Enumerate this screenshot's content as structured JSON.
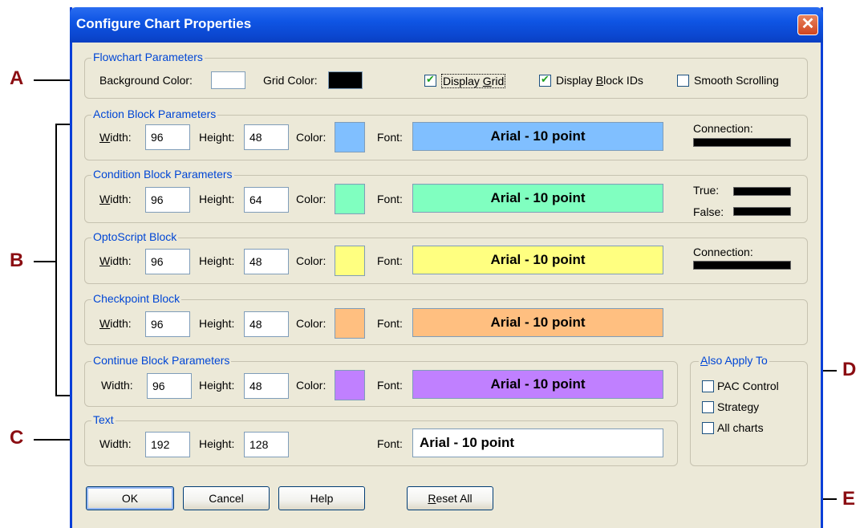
{
  "window": {
    "title": "Configure Chart Properties",
    "close_icon": "close-icon"
  },
  "callouts": {
    "a": "A",
    "b": "B",
    "c": "C",
    "d": "D",
    "e": "E"
  },
  "flowchart": {
    "legend": "Flowchart Parameters",
    "background_color_label": "Background Color:",
    "background_color": "#ffffff",
    "grid_color_label": "Grid Color:",
    "grid_color": "#000000",
    "display_grid_pre": "Display ",
    "display_grid_key": "G",
    "display_grid_post": "rid",
    "display_grid_checked": true,
    "display_block_ids_pre": "Display ",
    "display_block_ids_key": "B",
    "display_block_ids_post": "lock IDs",
    "display_block_ids_checked": true,
    "smooth_scrolling": "Smooth Scrolling",
    "smooth_scrolling_checked": false
  },
  "labels": {
    "width_key": "W",
    "width_rest": "idth:",
    "width_plain": "Width:",
    "height": "Height:",
    "color": "Color:",
    "font": "Font:"
  },
  "action": {
    "legend": "Action Block Parameters",
    "width": "96",
    "height": "48",
    "color": "#80bfff",
    "font": "Arial - 10 point",
    "connection_label": "Connection:"
  },
  "condition": {
    "legend": "Condition Block Parameters",
    "width": "96",
    "height": "64",
    "color": "#80ffc0",
    "font": "Arial - 10 point",
    "true_label": "True:",
    "false_label": "False:"
  },
  "optoscript": {
    "legend": "OptoScript Block",
    "width": "96",
    "height": "48",
    "color": "#ffff80",
    "font": "Arial - 10 point",
    "connection_label": "Connection:"
  },
  "checkpoint": {
    "legend": "Checkpoint Block",
    "width": "96",
    "height": "48",
    "color": "#ffbf80",
    "font": "Arial - 10 point"
  },
  "continue": {
    "legend": "Continue Block Parameters",
    "width": "96",
    "height": "48",
    "color": "#c080ff",
    "font": "Arial - 10 point"
  },
  "text": {
    "legend": "Text",
    "width": "192",
    "height": "128",
    "font": "Arial - 10 point"
  },
  "also_apply": {
    "legend_key": "A",
    "legend_rest": "lso Apply To",
    "pac_control": "PAC Control",
    "strategy": "Strategy",
    "all_charts": "All charts"
  },
  "buttons": {
    "ok": "OK",
    "cancel": "Cancel",
    "help": "Help",
    "reset_key": "R",
    "reset_rest": "eset All"
  }
}
